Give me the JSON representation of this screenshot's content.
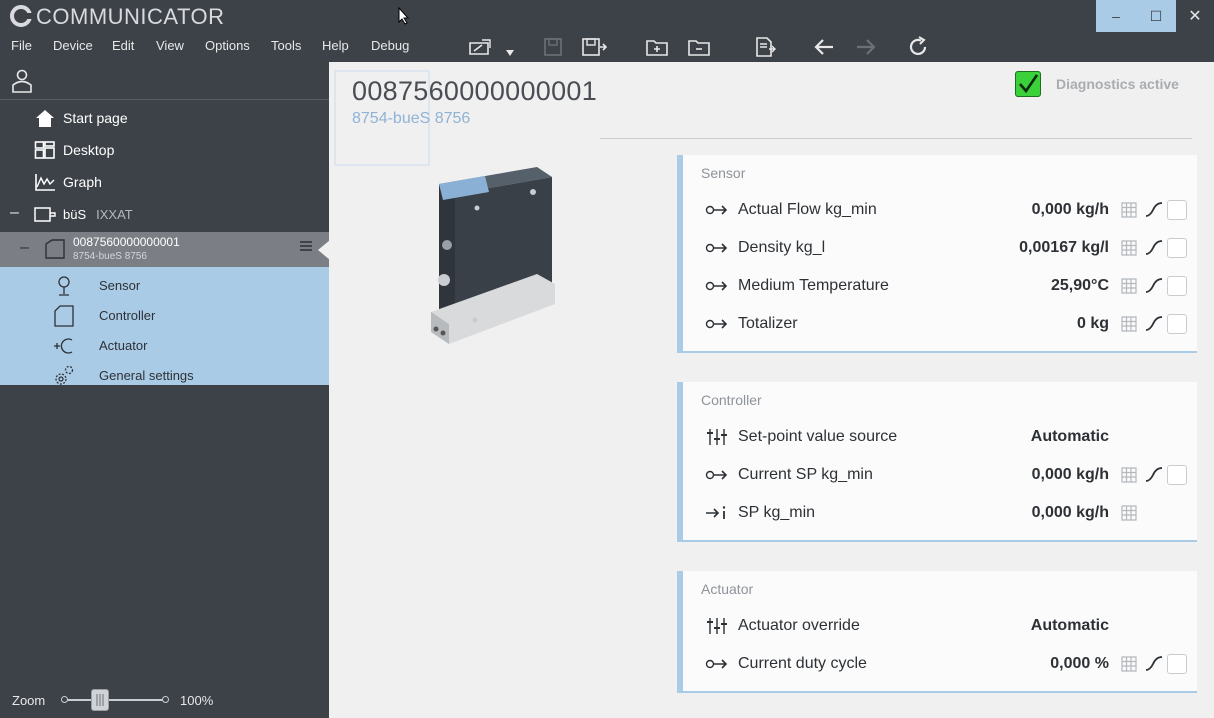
{
  "window": {
    "title": "COMMUNICATOR",
    "controls": {
      "minimize": "–",
      "maximize": "☐",
      "close": "✕"
    }
  },
  "menu": [
    "File",
    "Device",
    "Edit",
    "View",
    "Options",
    "Tools",
    "Help",
    "Debug"
  ],
  "toolbar": {
    "icons": [
      "device-scan-icon",
      "dropdown-arrow-icon",
      "save-disabled-icon",
      "save-as-icon",
      "add-folder-icon",
      "remove-folder-icon",
      "pdf-export-icon",
      "back-arrow-icon",
      "forward-arrow-icon",
      "refresh-icon"
    ]
  },
  "sidebar": {
    "nav": [
      {
        "label": "Start page",
        "icon": "home-icon"
      },
      {
        "label": "Desktop",
        "icon": "desktop-icon"
      },
      {
        "label": "Graph",
        "icon": "graph-icon"
      }
    ],
    "bus": {
      "collapse": "–",
      "label": "büS",
      "adapter": "IXXAT"
    },
    "device": {
      "collapse": "–",
      "id": "0087560000000001",
      "model": "8754-bueS 8756"
    },
    "sub_items": [
      {
        "label": "Sensor",
        "icon": "sensor-icon"
      },
      {
        "label": "Controller",
        "icon": "controller-icon"
      },
      {
        "label": "Actuator",
        "icon": "actuator-icon"
      },
      {
        "label": "General settings",
        "icon": "gears-icon"
      }
    ],
    "zoom": {
      "label": "Zoom",
      "value": "100%",
      "level": 0.35
    }
  },
  "device_header": {
    "title": "0087560000000001",
    "subtitle": "8754-bueS 8756",
    "diagnostics_label": "Diagnostics active",
    "diagnostics_on": true
  },
  "cards": {
    "sensor": {
      "title": "Sensor",
      "rows": [
        {
          "label": "Actual Flow kg_min",
          "value": "0,000 kg/h"
        },
        {
          "label": "Density kg_l",
          "value": "0,00167 kg/l"
        },
        {
          "label": "Medium Temperature",
          "value": "25,90°C"
        },
        {
          "label": "Totalizer",
          "value": "0 kg"
        }
      ]
    },
    "controller": {
      "title": "Controller",
      "rows": [
        {
          "label": "Set-point value source",
          "value": "Automatic"
        },
        {
          "label": "Current SP kg_min",
          "value": "0,000 kg/h"
        },
        {
          "label": "SP kg_min",
          "value": "0,000 kg/h"
        }
      ]
    },
    "actuator": {
      "title": "Actuator",
      "rows": [
        {
          "label": "Actuator override",
          "value": "Automatic"
        },
        {
          "label": "Current duty cycle",
          "value": "0,000 %"
        }
      ]
    }
  },
  "colors": {
    "dark": "#3d4249",
    "accent": "#aacbe6",
    "green": "#3bd13b",
    "link": "#8fb3d6"
  }
}
